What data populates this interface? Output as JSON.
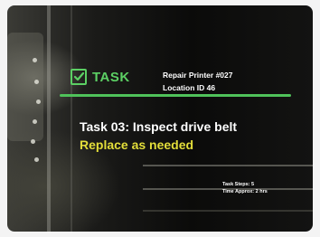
{
  "hud": {
    "badge_label": "TASK",
    "job_title": "Repair Printer #027",
    "location": "Location ID 46",
    "task_title": "Task 03: Inspect drive belt",
    "task_instruction": "Replace as needed",
    "task_steps": "Task Steps: 5",
    "time_approx": "Time Approx: 2 hrs",
    "accent_color": "#5cd064",
    "highlight_color": "#e3de3a"
  }
}
